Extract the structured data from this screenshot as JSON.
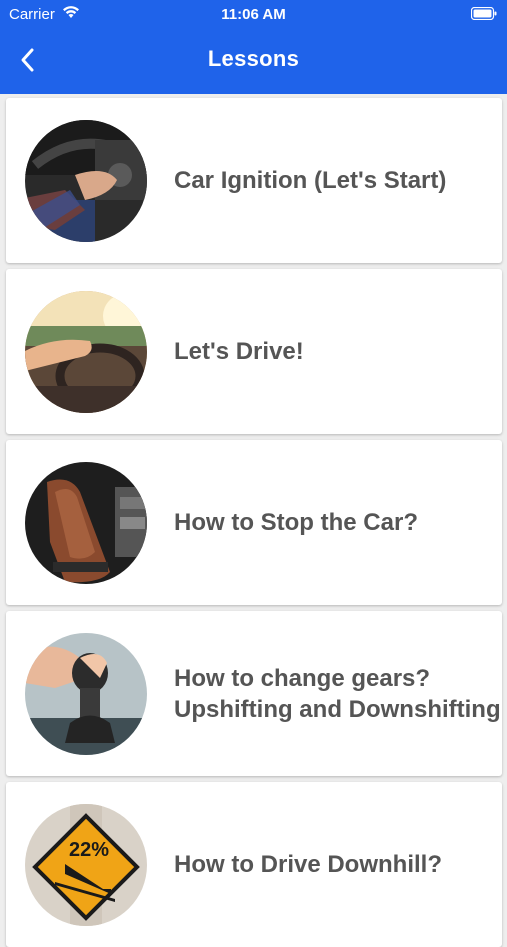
{
  "status_bar": {
    "carrier": "Carrier",
    "time": "11:06 AM",
    "icons": [
      "wifi-icon",
      "battery-icon"
    ]
  },
  "header": {
    "title": "Lessons",
    "back_icon": "chevron-left-icon",
    "background_color": "#1f63ea"
  },
  "lessons": [
    {
      "title": "Car Ignition (Let's Start)",
      "image": "car-ignition-photo"
    },
    {
      "title": "Let's Drive!",
      "image": "steering-wheel-photo"
    },
    {
      "title": "How to Stop the Car?",
      "image": "brake-pedal-photo"
    },
    {
      "title_line1": "How to change gears?",
      "title_line2": "Upshifting and Downshifting",
      "image": "gear-shift-photo"
    },
    {
      "title": "How to Drive Downhill?",
      "image": "downhill-sign-photo",
      "sign_text": "22%"
    }
  ]
}
